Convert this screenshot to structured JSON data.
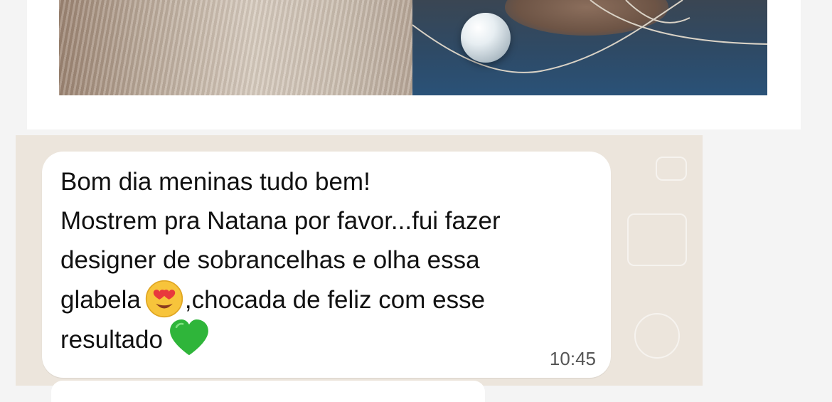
{
  "message": {
    "line1": "Bom dia meninas tudo bem!",
    "line2": "Mostrem pra Natana por favor...fui fazer",
    "line3": "designer de sobrancelhas e olha essa",
    "line4_before_emoji": "glabela",
    "line4_after_emoji": ",chocada de feliz com esse",
    "line5": "resultado",
    "timestamp": "10:45"
  },
  "emojis": {
    "first": "smiling-face-with-heart-eyes",
    "second": "green-heart"
  },
  "colors": {
    "chat_background": "#ece5dc",
    "bubble": "#ffffff",
    "page_background": "#f4f4f4",
    "green_heart": "#2fb53a"
  }
}
